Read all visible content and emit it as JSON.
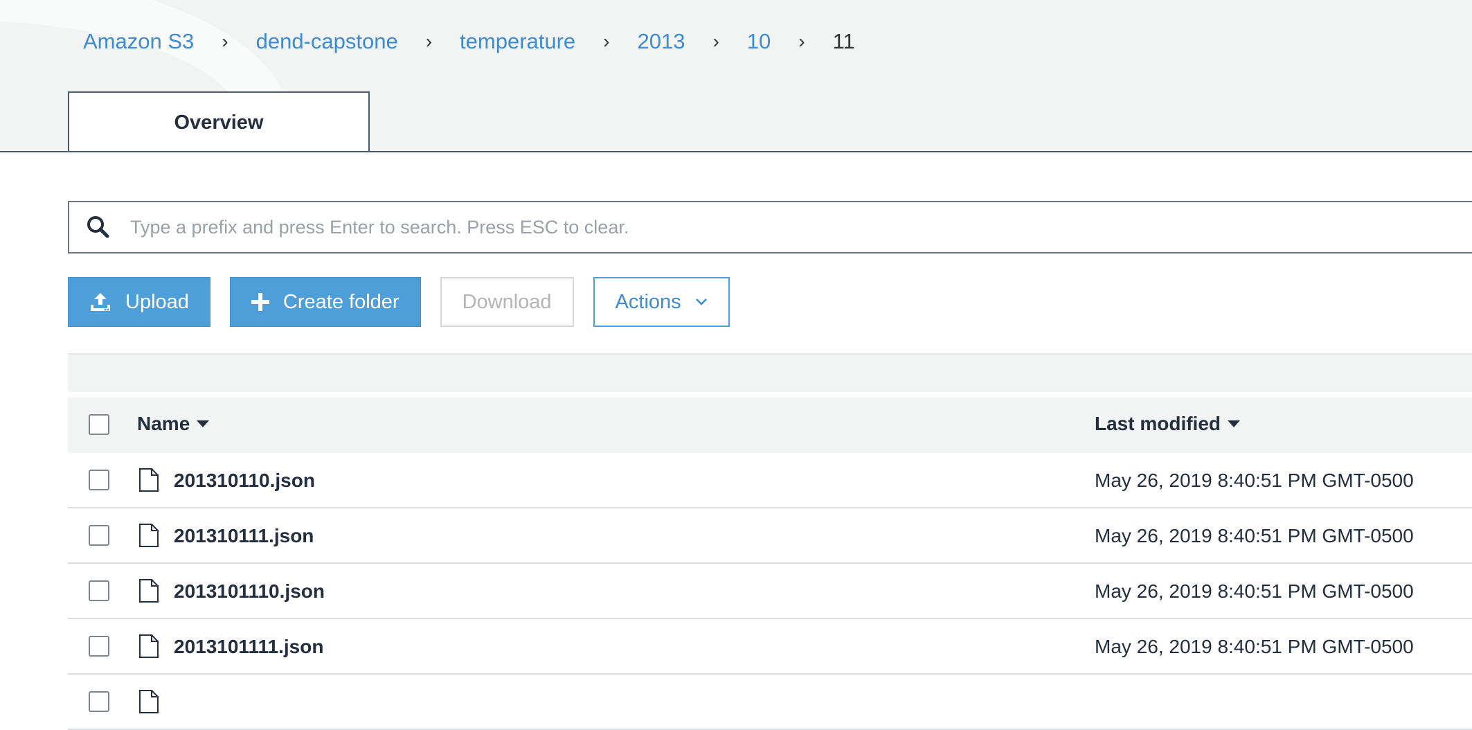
{
  "breadcrumb": {
    "items": [
      "Amazon S3",
      "dend-capstone",
      "temperature",
      "2013",
      "10"
    ],
    "current": "11"
  },
  "tabs": {
    "overview": "Overview"
  },
  "search": {
    "placeholder": "Type a prefix and press Enter to search. Press ESC to clear.",
    "value": ""
  },
  "toolbar": {
    "upload_label": "Upload",
    "create_folder_label": "Create folder",
    "download_label": "Download",
    "actions_label": "Actions"
  },
  "table": {
    "columns": {
      "name": "Name",
      "last_modified": "Last modified"
    },
    "rows": [
      {
        "name": "201310110.json",
        "modified": "May 26, 2019 8:40:51 PM GMT-0500"
      },
      {
        "name": "201310111.json",
        "modified": "May 26, 2019 8:40:51 PM GMT-0500"
      },
      {
        "name": "2013101110.json",
        "modified": "May 26, 2019 8:40:51 PM GMT-0500"
      },
      {
        "name": "2013101111.json",
        "modified": "May 26, 2019 8:40:51 PM GMT-0500"
      },
      {
        "name": "",
        "modified": ""
      }
    ]
  },
  "colors": {
    "link": "#3d8bd0",
    "primary_button": "#4e9ed9",
    "header_bg": "#f2f4f4",
    "text": "#232f3e"
  },
  "icons": [
    "search-icon",
    "upload-icon",
    "plus-icon",
    "chevron-down-icon",
    "sort-caret-icon",
    "file-icon"
  ]
}
